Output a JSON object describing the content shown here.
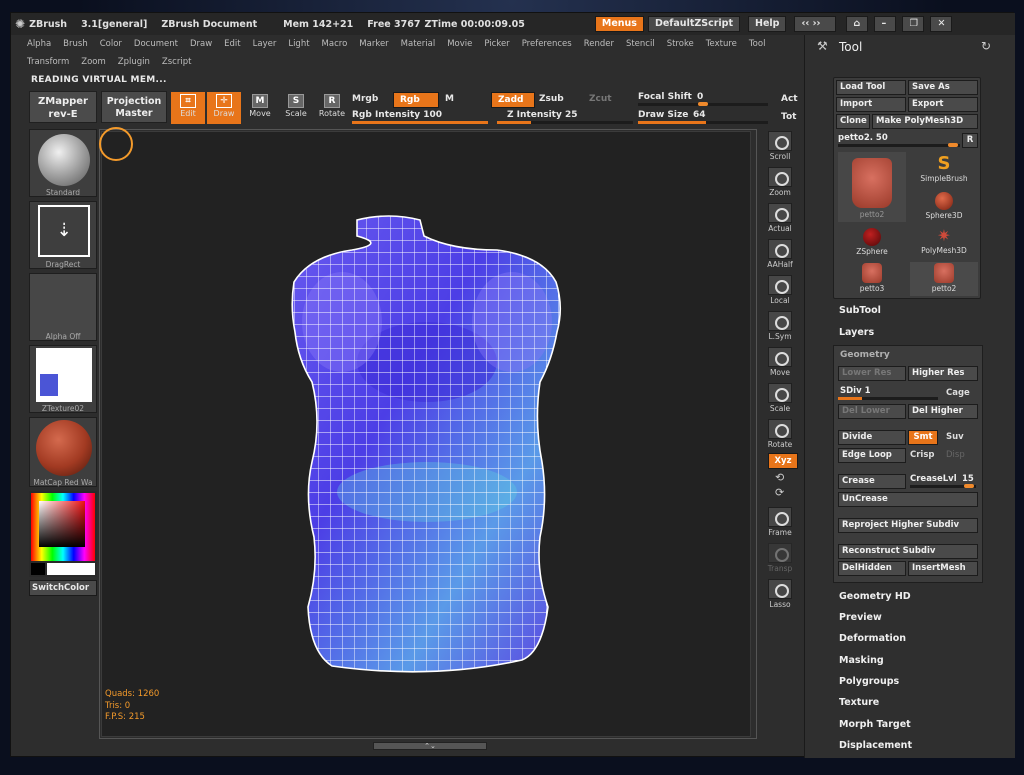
{
  "titlebar": {
    "app": "ZBrush",
    "version": "3.1[general]",
    "document": "ZBrush Document",
    "mem": "Mem 142+21",
    "free": "Free 3767",
    "ztime": "ZTime 00:00:09.05",
    "menus_btn": "Menus",
    "script_btn": "DefaultZScript",
    "help_btn": "Help"
  },
  "menubar": [
    "Alpha",
    "Brush",
    "Color",
    "Document",
    "Draw",
    "Edit",
    "Layer",
    "Light",
    "Macro",
    "Marker",
    "Material",
    "Movie",
    "Picker",
    "Preferences",
    "Render",
    "Stencil",
    "Stroke",
    "Texture",
    "Tool"
  ],
  "menubar2": [
    "Transform",
    "Zoom",
    "Zplugin",
    "Zscript"
  ],
  "status": "READING VIRTUAL MEM...",
  "toolbar": {
    "zmapper": "ZMapper",
    "zmapper_sub": "rev-E",
    "projection": "Projection",
    "projection_sub": "Master",
    "edit": "Edit",
    "draw": "Draw",
    "move": "Move",
    "scale": "Scale",
    "rotate": "Rotate",
    "mrgb": "Mrgb",
    "rgb": "Rgb",
    "m": "M",
    "zadd": "Zadd",
    "zsub": "Zsub",
    "zcut": "Zcut",
    "rgb_intensity": "Rgb Intensity 100",
    "z_intensity": "Z Intensity 25",
    "focal_shift_label": "Focal Shift",
    "focal_shift_value": "0",
    "draw_size_label": "Draw Size",
    "draw_size_value": "64",
    "act": "Act",
    "tot": "Tot"
  },
  "left_tiles": {
    "brush": "Standard",
    "stroke": "DragRect",
    "alpha": "Alpha Off",
    "texture": "ZTexture02",
    "material": "MatCap Red Wa",
    "switch_color": "SwitchColor"
  },
  "stats": {
    "quads": "Quads: 1260",
    "tris": "Tris: 0",
    "fps": "F.P.S: 215"
  },
  "right_toolbar": [
    "Scroll",
    "Zoom",
    "Actual",
    "AAHalf",
    "Local",
    "L.Sym",
    "Move",
    "Scale",
    "Rotate",
    "Frame",
    "Transp",
    "Lasso"
  ],
  "right_toolbar_xyz": "Xyz",
  "tool_panel": {
    "title": "Tool",
    "load_tool": "Load Tool",
    "save_as": "Save As",
    "import": "Import",
    "export": "Export",
    "clone": "Clone",
    "make_polymesh": "Make PolyMesh3D",
    "current_label": "petto2. 50",
    "r_btn": "R",
    "thumbs": [
      "petto2",
      "SimpleBrush",
      "Sphere3D",
      "ZSphere",
      "PolyMesh3D",
      "petto3",
      "petto2"
    ]
  },
  "sections": {
    "subtool": "SubTool",
    "layers": "Layers",
    "geometry_hd": "Geometry HD",
    "preview": "Preview",
    "deformation": "Deformation",
    "masking": "Masking",
    "polygroups": "Polygroups",
    "texture": "Texture",
    "morph_target": "Morph Target",
    "displacement": "Displacement"
  },
  "geometry": {
    "title": "Geometry",
    "lower_res": "Lower Res",
    "higher_res": "Higher Res",
    "sdiv": "SDiv 1",
    "sdiv_level": 1,
    "cage": "Cage",
    "del_lower": "Del Lower",
    "del_higher": "Del Higher",
    "divide": "Divide",
    "smt": "Smt",
    "suv": "Suv",
    "edge_loop": "Edge Loop",
    "crisp": "Crisp",
    "disp": "Disp",
    "crease": "Crease",
    "crease_lvl_label": "CreaseLvl",
    "crease_lvl_value": "15",
    "uncrease": "UnCrease",
    "reproject": "Reproject Higher Subdiv",
    "reconstruct": "Reconstruct Subdiv",
    "delhidden": "DelHidden",
    "insertmesh": "InsertMesh"
  },
  "colors": {
    "accent": "#e8751a",
    "panel": "#3c3c3c",
    "canvas": "#222222",
    "stat_text": "#f39a2b"
  }
}
